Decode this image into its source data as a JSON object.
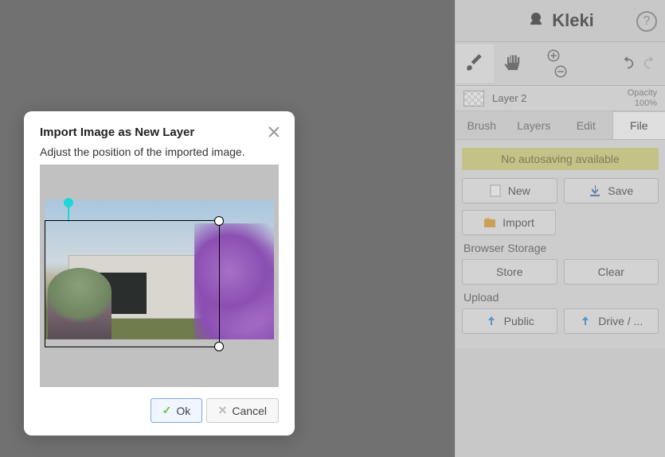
{
  "app": {
    "name": "Kleki"
  },
  "modal": {
    "title": "Import Image as New Layer",
    "subtitle": "Adjust the position of the imported image.",
    "ok_label": "Ok",
    "cancel_label": "Cancel"
  },
  "layer": {
    "name": "Layer 2",
    "opacity_label": "Opacity",
    "opacity_value": "100%"
  },
  "tabs": {
    "brush": "Brush",
    "layers": "Layers",
    "edit": "Edit",
    "file": "File",
    "active": "file"
  },
  "file_panel": {
    "autosave_msg": "No autosaving available",
    "new_label": "New",
    "save_label": "Save",
    "import_label": "Import",
    "browser_storage_label": "Browser Storage",
    "store_label": "Store",
    "clear_label": "Clear",
    "upload_label": "Upload",
    "public_label": "Public",
    "drive_label": "Drive / ..."
  },
  "icons": {
    "brush": "brush-icon",
    "hand": "hand-icon",
    "zoom_in": "plus-icon",
    "zoom_out": "minus-icon",
    "undo": "undo-icon",
    "redo": "redo-icon",
    "help": "?",
    "new": "new-doc-icon",
    "save": "download-icon",
    "import": "import-icon",
    "upload": "upload-icon"
  },
  "colors": {
    "accent": "#1fd6d6",
    "ok_border": "#7aa7e8",
    "autosave_bg": "#d6d57a"
  }
}
